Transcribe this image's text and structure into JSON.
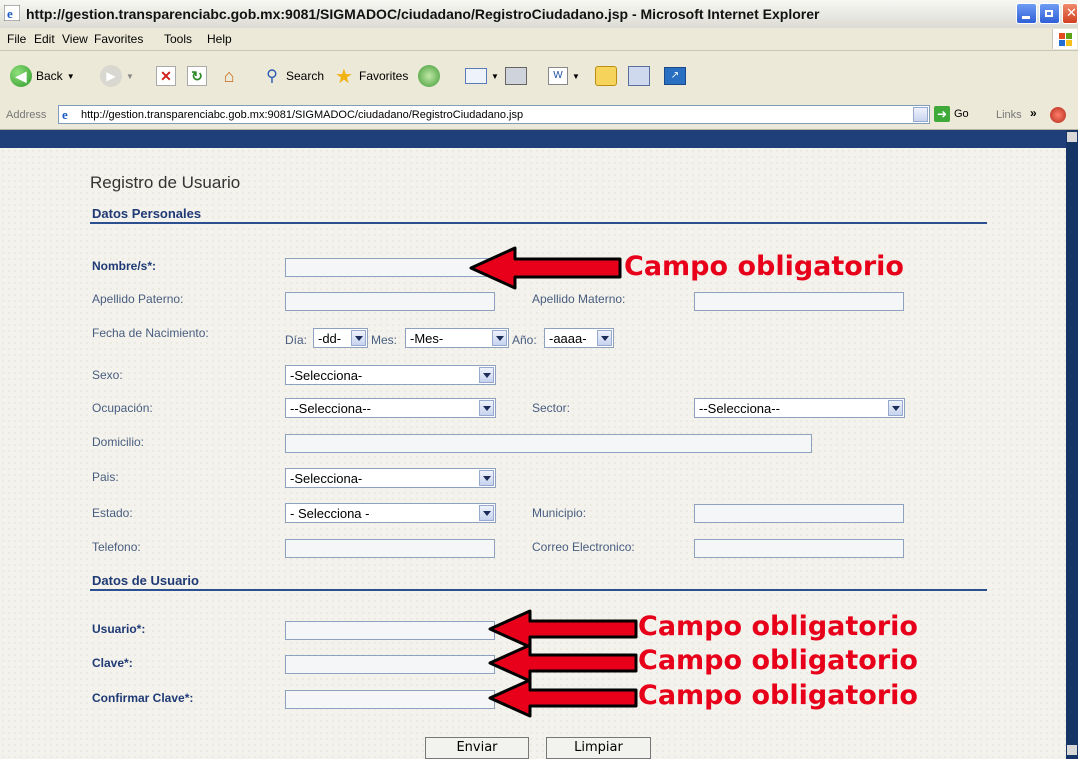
{
  "window": {
    "title": "http://gestion.transparenciabc.gob.mx:9081/SIGMADOC/ciudadano/RegistroCiudadano.jsp - Microsoft Internet Explorer"
  },
  "menu": [
    "File",
    "Edit",
    "View",
    "Favorites",
    "Tools",
    "Help"
  ],
  "toolbar": {
    "back": "Back",
    "search": "Search",
    "favorites": "Favorites"
  },
  "address": {
    "label": "Address",
    "url": "http://gestion.transparenciabc.gob.mx:9081/SIGMADOC/ciudadano/RegistroCiudadano.jsp",
    "go": "Go",
    "links": "Links"
  },
  "form": {
    "title": "Registro de Usuario",
    "section_personal": "Datos Personales",
    "section_user": "Datos de Usuario",
    "labels": {
      "nombre": "Nombre/s*:",
      "apellido_paterno": "Apellido Paterno:",
      "apellido_materno": "Apellido Materno:",
      "fecha": "Fecha de Nacimiento:",
      "dia": "Día:",
      "mes": "Mes:",
      "anio": "Año:",
      "sexo": "Sexo:",
      "ocupacion": "Ocupación:",
      "sector": "Sector:",
      "domicilio": "Domicilio:",
      "pais": "Pais:",
      "estado": "Estado:",
      "municipio": "Municipio:",
      "telefono": "Telefono:",
      "correo": "Correo Electronico:",
      "usuario": "Usuario*:",
      "clave": "Clave*:",
      "confirmar": "Confirmar Clave*:"
    },
    "selects": {
      "dia": "-dd-",
      "mes": "-Mes-",
      "anio": "-aaaa-",
      "sexo": "-Selecciona-",
      "ocupacion": "--Selecciona--",
      "sector": "--Selecciona--",
      "pais": "-Selecciona-",
      "estado": "- Selecciona -"
    },
    "buttons": {
      "enviar": "Enviar",
      "limpiar": "Limpiar"
    }
  },
  "annotations": {
    "required": "Campo obligatorio"
  },
  "colors": {
    "annotation_red": "#e8001a",
    "header_blue": "#1f3a75"
  }
}
